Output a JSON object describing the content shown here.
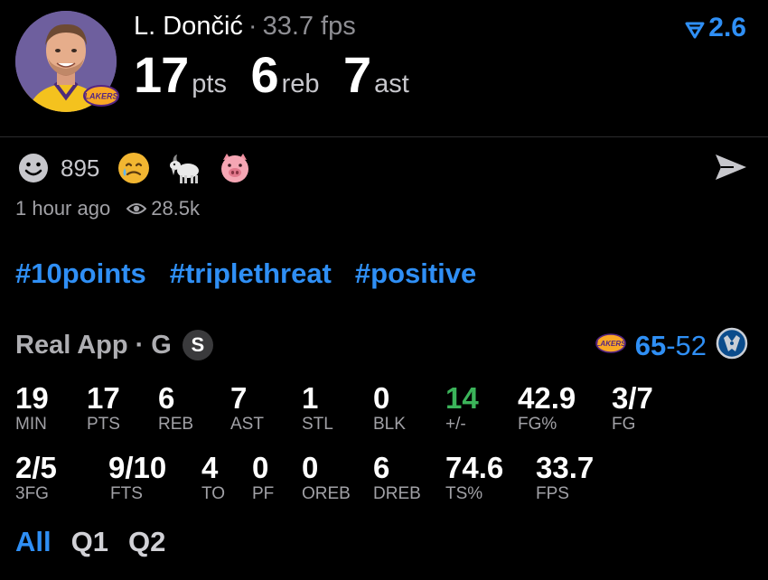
{
  "header": {
    "player_name": "L. Dončić",
    "separator": "·",
    "fps_text": "33.7 fps",
    "trend_value": "2.6",
    "stats": [
      {
        "value": "17",
        "unit": "pts"
      },
      {
        "value": "6",
        "unit": "reb"
      },
      {
        "value": "7",
        "unit": "ast"
      }
    ]
  },
  "reactions": {
    "count": "895",
    "items": [
      "smiley",
      "sad-tear",
      "goat",
      "pig"
    ]
  },
  "meta": {
    "time_ago": "1 hour ago",
    "views": "28.5k"
  },
  "tags": [
    "#10points",
    "#triplethreat",
    "#positive"
  ],
  "game": {
    "source": "Real App",
    "dot": "·",
    "position": "G",
    "badge": "S",
    "team_score": "65",
    "dash": "-",
    "opp_score": "52"
  },
  "stats_row1": [
    {
      "value": "19",
      "label": "MIN"
    },
    {
      "value": "17",
      "label": "PTS"
    },
    {
      "value": "6",
      "label": "REB"
    },
    {
      "value": "7",
      "label": "AST"
    },
    {
      "value": "1",
      "label": "STL"
    },
    {
      "value": "0",
      "label": "BLK"
    },
    {
      "value": "14",
      "label": "+/-"
    },
    {
      "value": "42.9",
      "label": "FG%"
    },
    {
      "value": "3/7",
      "label": "FG"
    }
  ],
  "stats_row2": [
    {
      "value": "2/5",
      "label": "3FG"
    },
    {
      "value": "9/10",
      "label": "FTS"
    },
    {
      "value": "4",
      "label": "TO"
    },
    {
      "value": "0",
      "label": "PF"
    },
    {
      "value": "0",
      "label": "OREB"
    },
    {
      "value": "6",
      "label": "DREB"
    },
    {
      "value": "74.6",
      "label": "TS%"
    },
    {
      "value": "33.7",
      "label": "FPS"
    }
  ],
  "periods": [
    {
      "label": "All",
      "active": true
    },
    {
      "label": "Q1",
      "active": false
    },
    {
      "label": "Q2",
      "active": false
    }
  ],
  "colors": {
    "accent": "#2f8ff5",
    "positive": "#3bb45a",
    "muted": "#a1a1a6",
    "background": "#000000"
  }
}
